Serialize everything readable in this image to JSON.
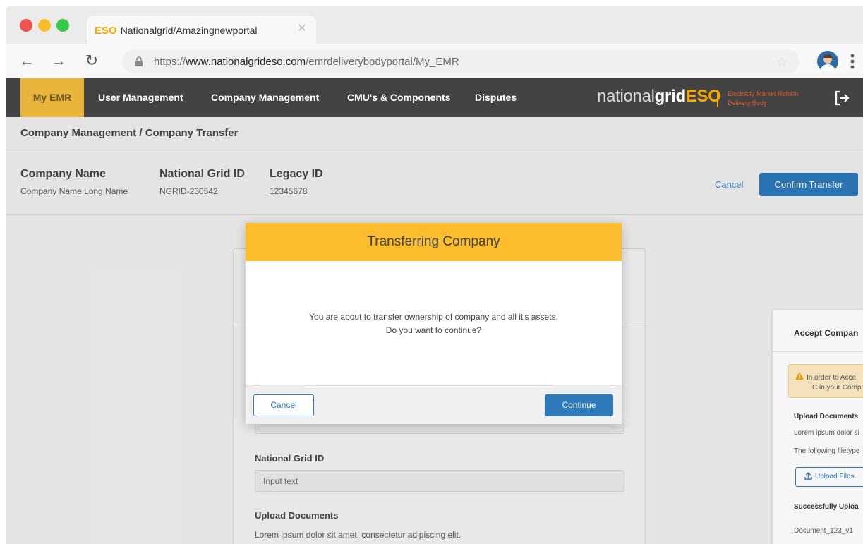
{
  "browser": {
    "tab": {
      "eso": "ESO",
      "title": "Nationalgrid/Amazingnewportal"
    },
    "url": {
      "scheme": "https://",
      "host": "www.nationalgrideso.com",
      "path": "/emrdeliverybodyportal/My_EMR"
    },
    "icons": {
      "back": "arrow-left-icon",
      "forward": "arrow-right-icon",
      "reload": "reload-icon",
      "lock": "lock-icon",
      "bookmark": "star-icon",
      "menu": "kebab-icon"
    }
  },
  "nav": {
    "items": [
      {
        "label": "My EMR",
        "active": true
      },
      {
        "label": "User Management"
      },
      {
        "label": "Company Management"
      },
      {
        "label": "CMU's & Components"
      },
      {
        "label": "Disputes"
      }
    ],
    "brand": {
      "prefix": "national",
      "bold": "grid",
      "accent": "ESO",
      "sub1": "Electricity Market Reform",
      "sub2": "Delivery Body"
    }
  },
  "breadcrumb": "Company Management / Company Transfer",
  "company": {
    "name_label": "Company Name",
    "name_value": "Company Name Long Name",
    "ngid_label": "National Grid ID",
    "ngid_value": "NGRID-230542",
    "legacy_label": "Legacy ID",
    "legacy_value": "12345678"
  },
  "actions": {
    "cancel": "Cancel",
    "confirm": "Confirm Transfer"
  },
  "form": {
    "ngid_label": "National Grid ID",
    "ngid_placeholder": "Input text",
    "upload_label": "Upload Documents",
    "upload_desc": "Lorem ipsum dolor sit amet, consectetur adipiscing elit."
  },
  "side": {
    "title": "Accept Compan",
    "warning_1": "In order to Acce",
    "warning_2": "C in your Comp",
    "upload_label": "Upload Documents",
    "upload_desc": "Lorem ipsum dolor si",
    "filetypes": "The following filetype",
    "upload_button": "Upload Files",
    "success_label": "Successfully Uploa",
    "document": "Document_123_v1"
  },
  "modal": {
    "title": "Transferring Company",
    "message_1": "You are about to transfer ownership of company and all it's assets.",
    "message_2": "Do you want to continue?",
    "cancel": "Cancel",
    "continue": "Continue"
  },
  "colors": {
    "accent": "#fbbd2e",
    "nav_bg": "#434343",
    "primary": "#2d79ba",
    "eso_orange": "#f5a800"
  }
}
